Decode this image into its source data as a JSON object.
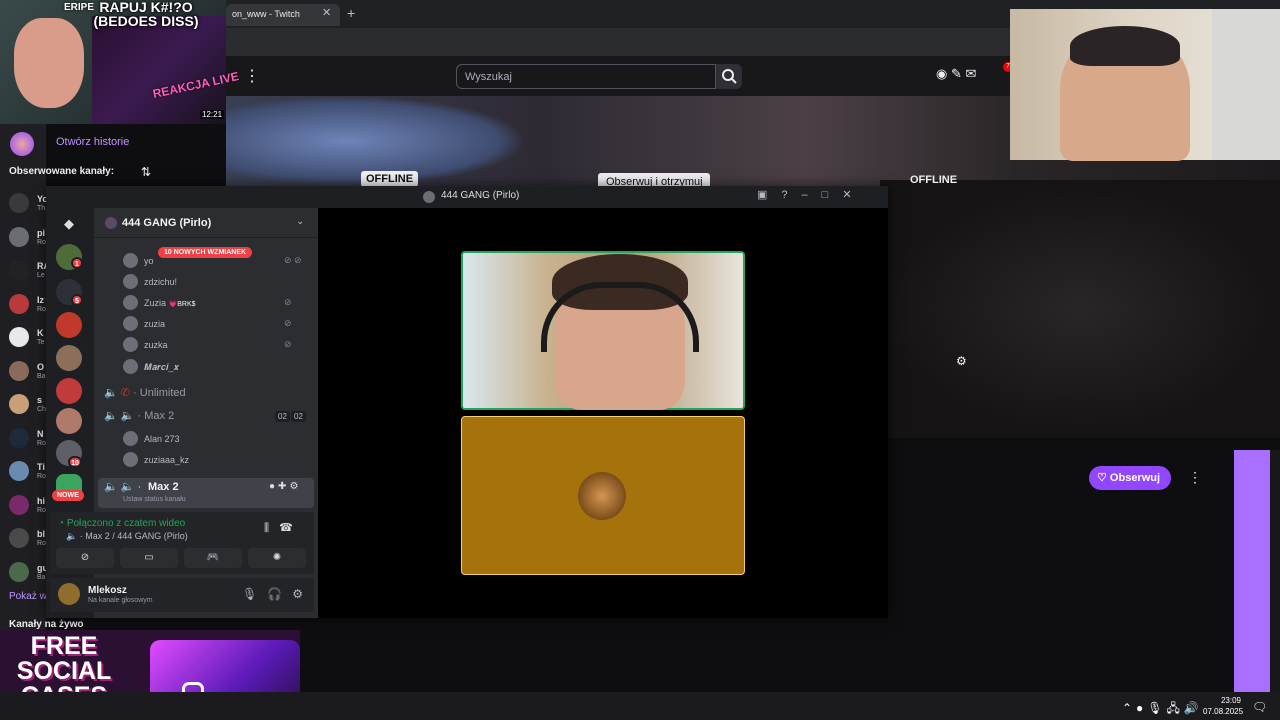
{
  "browser": {
    "tab_title": "on_www - Twitch",
    "tab_close": "✕",
    "new_tab": "+"
  },
  "twitch": {
    "search_placeholder": "Wyszukaj",
    "notification_count": "7",
    "offline_label": "OFFLINE",
    "offline_label_2": "OFFLINE",
    "follow_tooltip": "Obserwuj i otrzymuj",
    "follow_button": "Obserwuj",
    "sidebar": {
      "history_link": "Otwórz historie",
      "followed_heading": "Obserwowane kanały:",
      "show_more": "Pokaż w",
      "live_heading": "Kanały na żywo",
      "channels": [
        {
          "name": "Yo",
          "sub": "Th"
        },
        {
          "name": "pi",
          "sub": "Ro"
        },
        {
          "name": "RA",
          "sub": "Le"
        },
        {
          "name": "Iz",
          "sub": "Ro"
        },
        {
          "name": "K",
          "sub": "Te"
        },
        {
          "name": "O",
          "sub": "Ba"
        },
        {
          "name": "s",
          "sub": "Ch"
        },
        {
          "name": "N",
          "sub": "Ro"
        },
        {
          "name": "Ti",
          "sub": "Ro"
        },
        {
          "name": "hi",
          "sub": "Ro"
        },
        {
          "name": "bl",
          "sub": "Ro"
        },
        {
          "name": "gu",
          "sub": "Ba"
        }
      ]
    }
  },
  "thumbnail": {
    "label": "ERIPE",
    "title_line1": "RAPUJ K#!?O",
    "title_line2": "(BEDOES DISS)",
    "live_text": "REAKCJA LIVE",
    "duration": "12:21"
  },
  "ad": {
    "text": "FREE SOCIAL CASES"
  },
  "taskbar": {
    "time": "23:09",
    "date": "07.08.2025"
  },
  "discord": {
    "window_title": "444 GANG (Pirlo)",
    "server_name": "444 GANG (Pirlo)",
    "mentions_pill": "10 NOWYCH WZMIANEK",
    "new_badge": "NOWE",
    "server_badges": [
      "1",
      "5",
      "10"
    ],
    "voice_users_top": [
      {
        "name": "zdzichu!"
      },
      {
        "name": "Zuzia",
        "tag": "💗BRK$"
      },
      {
        "name": "zuzia"
      },
      {
        "name": "zuzka"
      },
      {
        "name": "𝑴𝒂𝒓𝒄𝒊_𝒙"
      }
    ],
    "partial_user": "yo",
    "channels": [
      {
        "name": "Unlimited"
      },
      {
        "name": "Max 2",
        "count_a": "02",
        "count_b": "02"
      }
    ],
    "channel_users": [
      {
        "name": "Alan 273"
      },
      {
        "name": "zuziaaa_kz"
      }
    ],
    "active_channel": {
      "name": "Max 2",
      "status": "Ustaw status kanału"
    },
    "voice": {
      "status": "Połączono z czatem wideo",
      "channel": "Max 2 / 444 GANG (Pirlo)"
    },
    "user": {
      "name": "Mlekosz",
      "status": "Na kanale głosowym"
    }
  }
}
